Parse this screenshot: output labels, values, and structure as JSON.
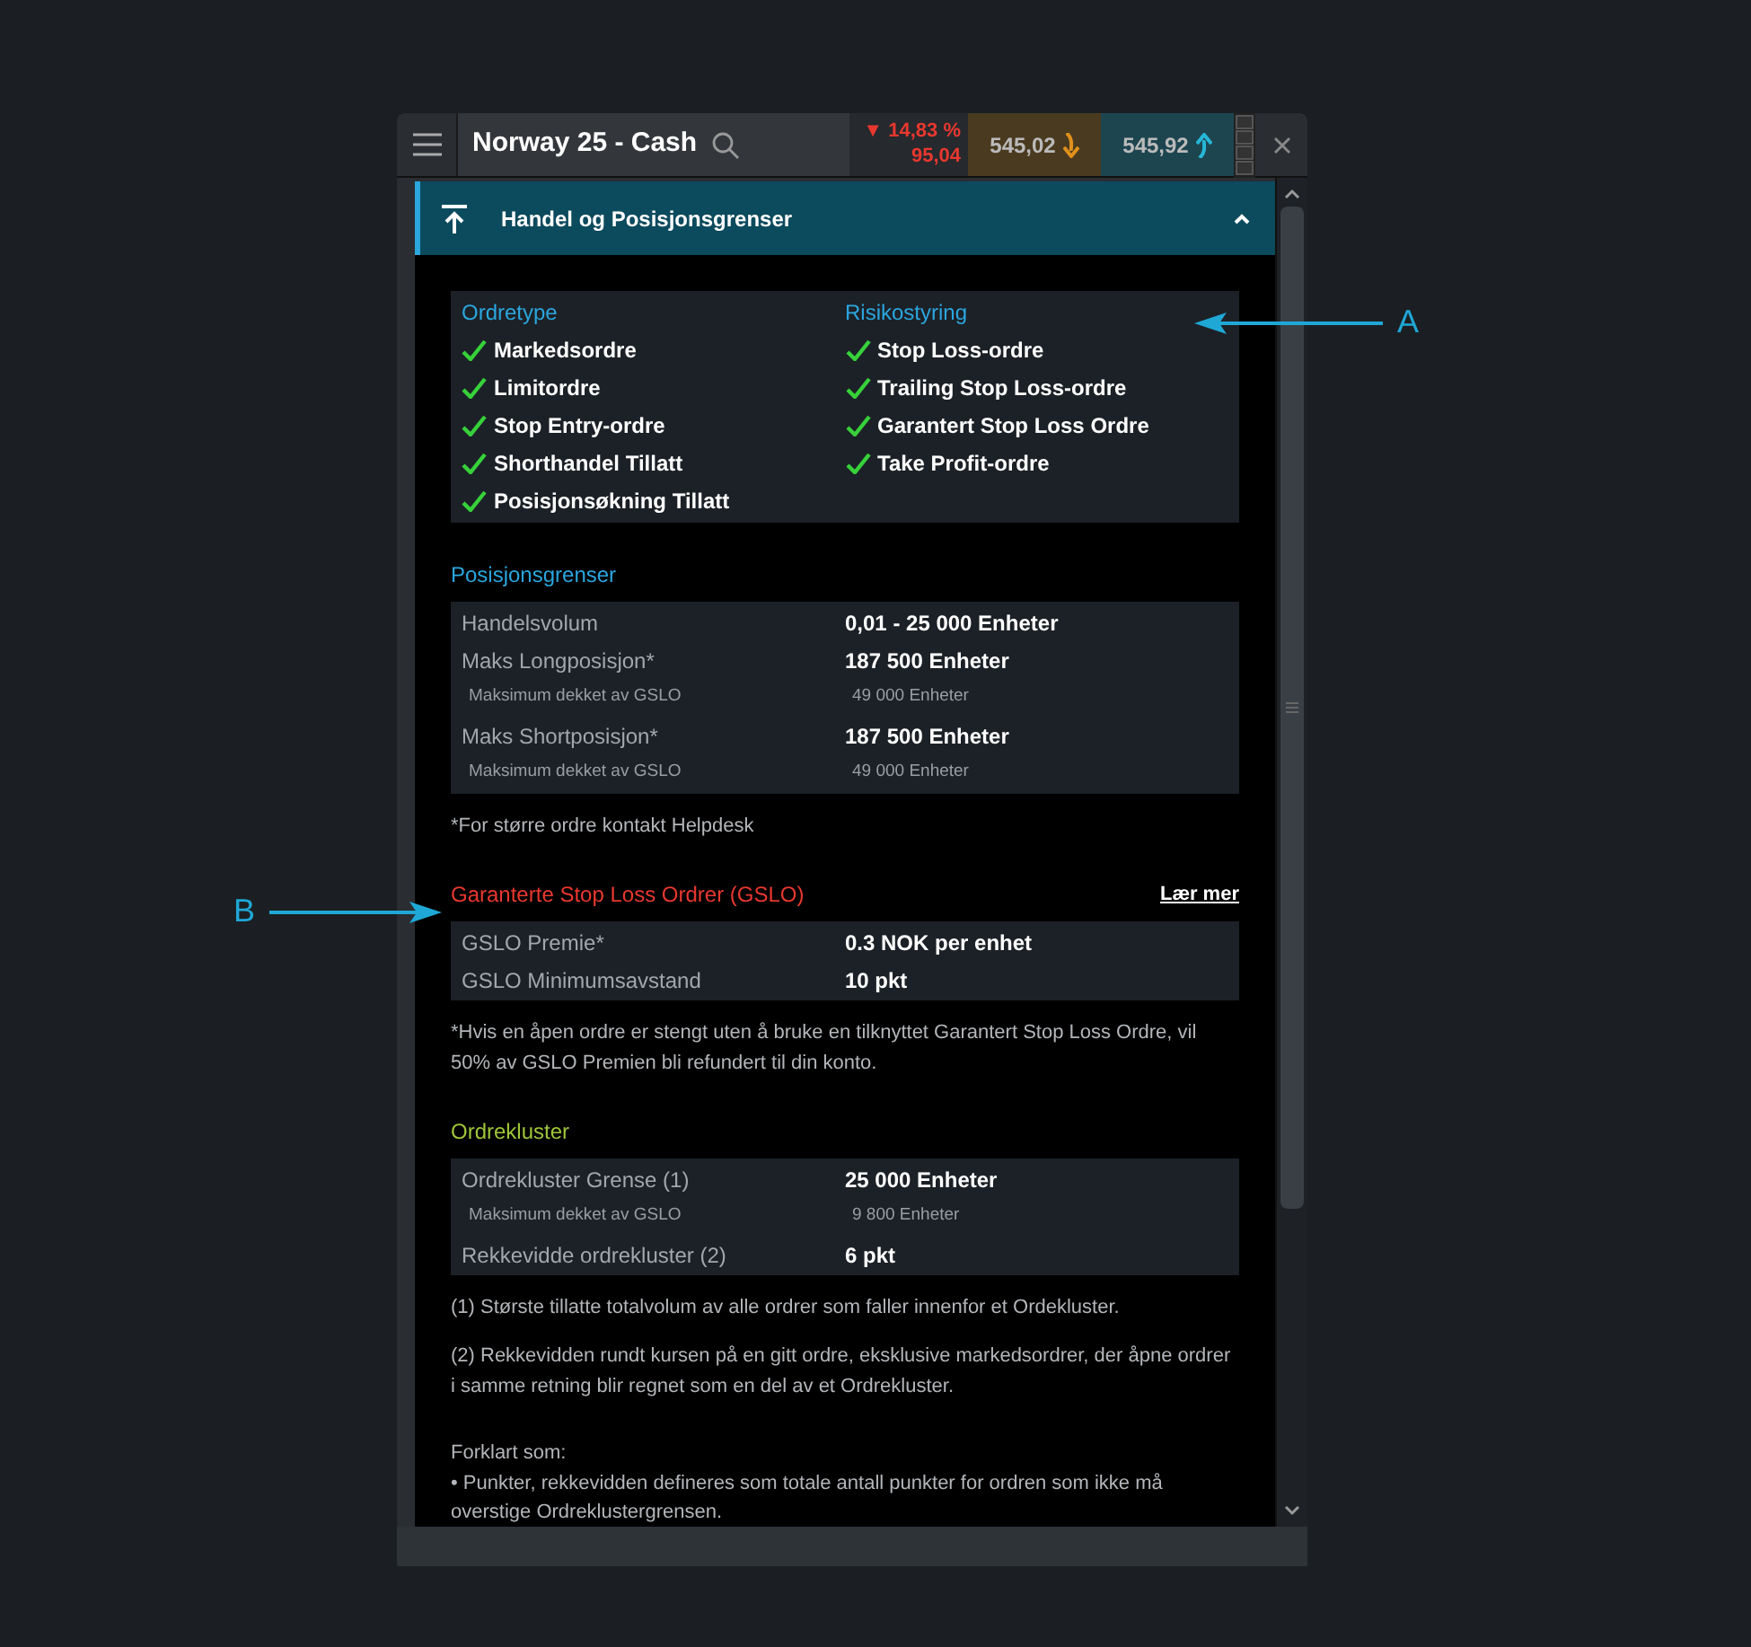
{
  "header": {
    "title": "Norway 25 - Cash",
    "change": {
      "arrow": "▼",
      "percent": "14,83 %",
      "points": "95,04"
    },
    "sell": "545,02",
    "buy": "545,92"
  },
  "section": {
    "title": "Handel og Posisjonsgrenser",
    "expanded": true
  },
  "features": [
    {
      "heading": "Ordretype",
      "items": [
        {
          "label": "Markedsordre",
          "checked": true
        },
        {
          "label": "Limitordre",
          "checked": true
        },
        {
          "label": "Stop Entry-ordre",
          "checked": true
        },
        {
          "label": "Shorthandel Tillatt",
          "checked": true
        },
        {
          "label": "Posisjonsøkning Tillatt",
          "checked": true
        }
      ]
    },
    {
      "heading": "Risikostyring",
      "items": [
        {
          "label": "Stop Loss-ordre",
          "checked": true
        },
        {
          "label": "Trailing Stop Loss-ordre",
          "checked": true
        },
        {
          "label": "Garantert Stop Loss Ordre",
          "checked": true
        },
        {
          "label": "Take Profit-ordre",
          "checked": true
        }
      ]
    }
  ],
  "groups": [
    {
      "heading": "Posisjonsgrenser",
      "color": "#2ba6de",
      "rows": [
        {
          "kind": "main",
          "label": "Handelsvolum",
          "value": "0,01 - 25 000 Enheter"
        },
        {
          "kind": "main",
          "label": "Maks Longposisjon*",
          "value": "187 500 Enheter"
        },
        {
          "kind": "sub",
          "label": "Maksimum dekket av GSLO",
          "value": "49 000 Enheter"
        },
        {
          "kind": "main",
          "label": "Maks Shortposisjon*",
          "value": "187 500 Enheter"
        },
        {
          "kind": "sub",
          "label": "Maksimum dekket av GSLO",
          "value": "49 000 Enheter"
        }
      ],
      "notes": [
        "*For større ordre kontakt Helpdesk"
      ]
    },
    {
      "heading": "Garanterte Stop Loss Ordrer (GSLO)",
      "color": "#e8382f",
      "link": "Lær mer",
      "rows": [
        {
          "kind": "main",
          "label": "GSLO Premie*",
          "value": "0.3 NOK per enhet"
        },
        {
          "kind": "main",
          "label": "GSLO Minimumsavstand",
          "value": "10 pkt"
        }
      ],
      "notes": [
        "*Hvis en åpen ordre er stengt uten å bruke en tilknyttet Garantert Stop Loss Ordre, vil 50% av GSLO Premien bli refundert til din konto."
      ]
    },
    {
      "heading": "Ordrekluster",
      "color": "#9fc53a",
      "rows": [
        {
          "kind": "main",
          "label": "Ordrekluster Grense (1)",
          "value": "25 000 Enheter"
        },
        {
          "kind": "sub",
          "label": "Maksimum dekket av GSLO",
          "value": "9 800 Enheter"
        },
        {
          "kind": "main",
          "label": "Rekkevidde ordrekluster (2)",
          "value": "6 pkt"
        }
      ],
      "notes": [
        "(1) Største tillatte totalvolum av alle ordrer som faller innenfor et Ordekluster.",
        "(2) Rekkevidden rundt kursen på en gitt ordre, eksklusive markedsordrer, der åpne ordrer i samme retning blir regnet som en del av et Ordrekluster."
      ]
    }
  ],
  "explanation": {
    "title": "Forklart som:",
    "bullets": [
      "• Punkter, rekkevidden defineres som totale antall punkter for ordren som ikke må overstige Ordreklustergrensen."
    ]
  },
  "annotations": [
    {
      "label": "A"
    },
    {
      "label": "B"
    }
  ]
}
